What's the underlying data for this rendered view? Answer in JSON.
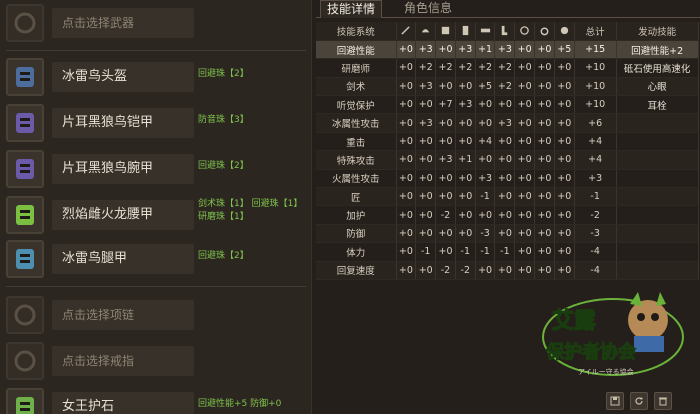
{
  "equipment": [
    {
      "label": "点击选择武器",
      "placeholder": true,
      "icon": "weapon-slot-icon",
      "deco": []
    },
    {
      "label": "冰雷鸟头盔",
      "placeholder": false,
      "icon": "helmet-icon",
      "deco": [
        "回避珠【2】"
      ]
    },
    {
      "label": "片耳黑狼鸟铠甲",
      "placeholder": false,
      "icon": "chest-armor-icon",
      "deco": [
        "防音珠【3】"
      ]
    },
    {
      "label": "片耳黑狼鸟腕甲",
      "placeholder": false,
      "icon": "arm-armor-icon",
      "deco": [
        "回避珠【2】"
      ]
    },
    {
      "label": "烈焰雌火龙腰甲",
      "placeholder": false,
      "icon": "waist-armor-icon",
      "deco": [
        "剑术珠【1】  回避珠【1】",
        "研磨珠【1】"
      ]
    },
    {
      "label": "冰雷鸟腿甲",
      "placeholder": false,
      "icon": "leg-armor-icon",
      "deco": [
        "回避珠【2】"
      ]
    },
    {
      "label": "点击选择项链",
      "placeholder": true,
      "icon": "necklace-slot-icon",
      "deco": []
    },
    {
      "label": "点击选择戒指",
      "placeholder": true,
      "icon": "ring-slot-icon",
      "deco": []
    },
    {
      "label": "女王护石",
      "placeholder": false,
      "icon": "talisman-icon",
      "deco": [
        "回避性能+5  防御+0"
      ]
    }
  ],
  "tabs": [
    {
      "label": "技能详情",
      "active": true
    },
    {
      "label": "角色信息",
      "active": false
    }
  ],
  "table": {
    "header_skill": "技能系统",
    "header_total": "总计",
    "header_active": "发动技能",
    "column_icons": [
      "weapon-icon",
      "helmet-icon",
      "chest-icon",
      "arm-icon",
      "waist-icon",
      "leg-icon",
      "necklace-icon",
      "ring-icon",
      "talisman-icon"
    ],
    "rows": [
      {
        "name": "回避性能",
        "vals": [
          "+0",
          "+3",
          "+0",
          "+3",
          "+1",
          "+3",
          "+0",
          "+0",
          "+5"
        ],
        "total": "+15"
      },
      {
        "name": "研磨师",
        "vals": [
          "+0",
          "+2",
          "+2",
          "+2",
          "+2",
          "+2",
          "+0",
          "+0",
          "+0"
        ],
        "total": "+10"
      },
      {
        "name": "剑术",
        "vals": [
          "+0",
          "+3",
          "+0",
          "+0",
          "+5",
          "+2",
          "+0",
          "+0",
          "+0"
        ],
        "total": "+10"
      },
      {
        "name": "听觉保护",
        "vals": [
          "+0",
          "+0",
          "+7",
          "+3",
          "+0",
          "+0",
          "+0",
          "+0",
          "+0"
        ],
        "total": "+10"
      },
      {
        "name": "冰属性攻击",
        "vals": [
          "+0",
          "+3",
          "+0",
          "+0",
          "+0",
          "+3",
          "+0",
          "+0",
          "+0"
        ],
        "total": "+6"
      },
      {
        "name": "重击",
        "vals": [
          "+0",
          "+0",
          "+0",
          "+0",
          "+4",
          "+0",
          "+0",
          "+0",
          "+0"
        ],
        "total": "+4"
      },
      {
        "name": "特殊攻击",
        "vals": [
          "+0",
          "+0",
          "+3",
          "+1",
          "+0",
          "+0",
          "+0",
          "+0",
          "+0"
        ],
        "total": "+4"
      },
      {
        "name": "火属性攻击",
        "vals": [
          "+0",
          "+0",
          "+0",
          "+0",
          "+3",
          "+0",
          "+0",
          "+0",
          "+0"
        ],
        "total": "+3"
      },
      {
        "name": "匠",
        "vals": [
          "+0",
          "+0",
          "+0",
          "+0",
          "-1",
          "+0",
          "+0",
          "+0",
          "+0"
        ],
        "total": "-1"
      },
      {
        "name": "加护",
        "vals": [
          "+0",
          "+0",
          "-2",
          "+0",
          "+0",
          "+0",
          "+0",
          "+0",
          "+0"
        ],
        "total": "-2"
      },
      {
        "name": "防御",
        "vals": [
          "+0",
          "+0",
          "+0",
          "+0",
          "-3",
          "+0",
          "+0",
          "+0",
          "+0"
        ],
        "total": "-3"
      },
      {
        "name": "体力",
        "vals": [
          "+0",
          "-1",
          "+0",
          "-1",
          "-1",
          "-1",
          "+0",
          "+0",
          "+0"
        ],
        "total": "-4"
      },
      {
        "name": "回复速度",
        "vals": [
          "+0",
          "+0",
          "-2",
          "-2",
          "+0",
          "+0",
          "+0",
          "+0",
          "+0"
        ],
        "total": "-4"
      }
    ],
    "active_skills": [
      "回避性能+2",
      "砥石使用高速化",
      "心眼",
      "耳栓"
    ]
  },
  "logo": {
    "title_line1": "艾露",
    "title_line2": "保护者协会",
    "subtitle": "アイルー守る協会"
  },
  "colors": {
    "accent_green": "#7fc44c",
    "highlight_row": "#4b443b"
  }
}
